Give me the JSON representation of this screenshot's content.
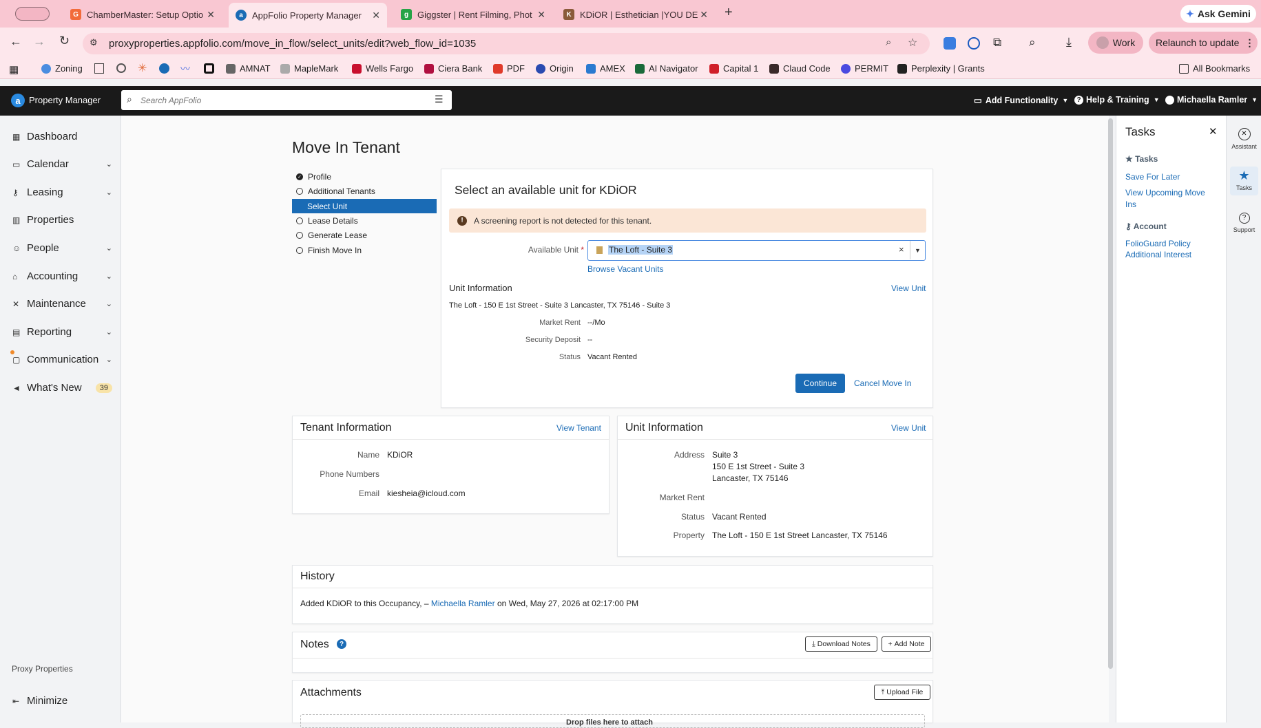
{
  "browser": {
    "tabs": [
      {
        "label": "ChamberMaster: Setup Optio",
        "icon_color": "#f26b3a",
        "icon": "G"
      },
      {
        "label": "AppFolio Property Manager",
        "icon_color": "#1a6bb5",
        "icon": "a"
      },
      {
        "label": "Giggster | Rent Filming, Phot",
        "icon_color": "#27a347",
        "icon": "g"
      },
      {
        "label": "KDiOR | Esthetician |YOU DE",
        "icon_color": "#8a5a3a",
        "icon": "K"
      }
    ],
    "ask_gemini": "Ask Gemini",
    "url": "proxyproperties.appfolio.com/move_in_flow/select_units/edit?web_flow_id=1035",
    "work_label": "Work",
    "relaunch_label": "Relaunch to update",
    "bookmarks": [
      "Zoning",
      "AMNAT",
      "MapleMark",
      "Wells Fargo",
      "Ciera Bank",
      "PDF",
      "Origin",
      "AMEX",
      "AI Navigator",
      "Capital 1",
      "Claud Code",
      "PERMIT",
      "Perplexity | Grants"
    ],
    "all_bookmarks": "All Bookmarks"
  },
  "app": {
    "logo_text": "Property Manager",
    "search_placeholder": "Search AppFolio",
    "add_functionality": "Add Functionality",
    "help_training": "Help & Training",
    "user": "Michaella Ramler"
  },
  "sidebar": {
    "items": [
      {
        "label": "Dashboard",
        "icon": "grid-icon",
        "has_chevron": false
      },
      {
        "label": "Calendar",
        "icon": "calendar-icon",
        "has_chevron": true
      },
      {
        "label": "Leasing",
        "icon": "key-icon",
        "has_chevron": true
      },
      {
        "label": "Properties",
        "icon": "building-icon",
        "has_chevron": false
      },
      {
        "label": "People",
        "icon": "person-icon",
        "has_chevron": true
      },
      {
        "label": "Accounting",
        "icon": "bank-icon",
        "has_chevron": true
      },
      {
        "label": "Maintenance",
        "icon": "tools-icon",
        "has_chevron": true
      },
      {
        "label": "Reporting",
        "icon": "table-icon",
        "has_chevron": true
      },
      {
        "label": "Communication",
        "icon": "chat-icon",
        "has_chevron": true
      },
      {
        "label": "What's New",
        "icon": "megaphone-icon",
        "has_chevron": false
      }
    ],
    "whats_new_count": "39",
    "company": "Proxy Properties",
    "minimize": "Minimize"
  },
  "page": {
    "title": "Move In Tenant",
    "steps": [
      {
        "label": "Profile",
        "state": "done"
      },
      {
        "label": "Additional Tenants",
        "state": "todo"
      },
      {
        "label": "Select Unit",
        "state": "active"
      },
      {
        "label": "Lease Details",
        "state": "todo"
      },
      {
        "label": "Generate Lease",
        "state": "todo"
      },
      {
        "label": "Finish Move In",
        "state": "todo"
      }
    ],
    "select_card": {
      "heading": "Select an available unit for KDiOR",
      "warning": "A screening report is not detected for this tenant.",
      "available_unit_label": "Available Unit",
      "available_unit_value": "The Loft - Suite 3",
      "browse_link": "Browse Vacant Units",
      "unit_info_heading": "Unit Information",
      "view_unit": "View Unit",
      "address_line": "The Loft - 150 E 1st Street - Suite 3 Lancaster, TX 75146 - Suite 3",
      "market_rent_label": "Market Rent",
      "market_rent_value": "--/Mo",
      "security_deposit_label": "Security Deposit",
      "security_deposit_value": "--",
      "status_label": "Status",
      "status_value": "Vacant Rented",
      "continue": "Continue",
      "cancel": "Cancel Move In"
    },
    "tenant_card": {
      "heading": "Tenant Information",
      "view_link": "View Tenant",
      "name_label": "Name",
      "name_value": "KDiOR",
      "phone_label": "Phone Numbers",
      "email_label": "Email",
      "email_value": "kiesheia@icloud.com"
    },
    "unit_card": {
      "heading": "Unit Information",
      "view_link": "View Unit",
      "address_label": "Address",
      "address_lines": [
        "Suite 3",
        "150 E 1st Street - Suite 3",
        "Lancaster, TX 75146"
      ],
      "market_rent_label": "Market Rent",
      "status_label": "Status",
      "status_value": "Vacant Rented",
      "property_label": "Property",
      "property_value": "The Loft - 150 E 1st Street Lancaster, TX 75146"
    },
    "history": {
      "heading": "History",
      "prefix": "Added KDiOR to this Occupancy, –",
      "user": "Michaella Ramler",
      "suffix": "on Wed, May 27, 2026 at 02:17:00 PM"
    },
    "notes": {
      "heading": "Notes",
      "download": "Download Notes",
      "add": "Add Note"
    },
    "attachments": {
      "heading": "Attachments",
      "upload": "Upload File",
      "drop_hint": "Drop files here to attach"
    }
  },
  "tasks_panel": {
    "title": "Tasks",
    "section1": "Tasks",
    "links1": [
      "Save For Later",
      "View Upcoming Move Ins"
    ],
    "section2": "Account",
    "links2": [
      "FolioGuard Policy Additional Interest"
    ]
  },
  "rail": {
    "assistant": "Assistant",
    "tasks": "Tasks",
    "support": "Support"
  }
}
